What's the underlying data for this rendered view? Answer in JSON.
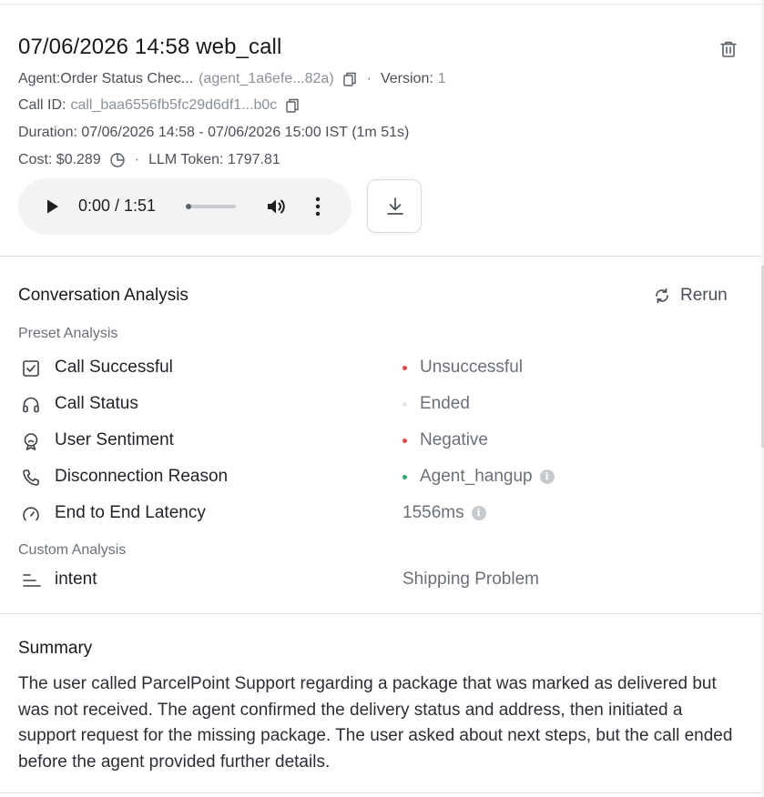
{
  "call": {
    "title": "07/06/2026 14:58 web_call",
    "agent_label": "Agent:Order Status Chec...",
    "agent_id": "(agent_1a6efe...82a)",
    "version_label": "Version:",
    "version_value": "1",
    "call_id_label": "Call ID:",
    "call_id_value": "call_baa6556fb5fc29d6df1...b0c",
    "duration": "Duration: 07/06/2026 14:58 - 07/06/2026 15:00 IST (1m 51s)",
    "cost": "Cost: $0.289",
    "llm_token": "LLM Token: 1797.81",
    "separator": "·"
  },
  "player": {
    "time": "0:00 / 1:51",
    "progress_fraction": 0.0
  },
  "analysis": {
    "title": "Conversation Analysis",
    "rerun_label": "Rerun",
    "preset_heading": "Preset Analysis",
    "preset": [
      {
        "label": "Call Successful",
        "value": "Unsuccessful",
        "icon": "checkbox-icon",
        "dot_color": "#e5484d"
      },
      {
        "label": "Call Status",
        "value": "Ended",
        "icon": "headset-icon",
        "dot_color": "#e6e8eb"
      },
      {
        "label": "User Sentiment",
        "value": "Negative",
        "icon": "sentiment-icon",
        "dot_color": "#e5484d"
      },
      {
        "label": "Disconnection Reason",
        "value": "Agent_hangup",
        "icon": "phone-icon",
        "dot_color": "#30a46c"
      },
      {
        "label": "End to End Latency",
        "value": "1556ms",
        "icon": "gauge-icon",
        "dot_color": ""
      }
    ],
    "custom_heading": "Custom Analysis",
    "custom": [
      {
        "label": "intent",
        "value": "Shipping Problem",
        "icon": "text-lines-icon"
      }
    ]
  },
  "summary": {
    "title": "Summary",
    "text": "The user called ParcelPoint Support regarding a package that was marked as delivered but was not received. The agent confirmed the delivery status and address, then initiated a support request for the missing package. The user asked about next steps, but the call ended before the agent provided further details."
  },
  "icons": {
    "info": "i"
  }
}
